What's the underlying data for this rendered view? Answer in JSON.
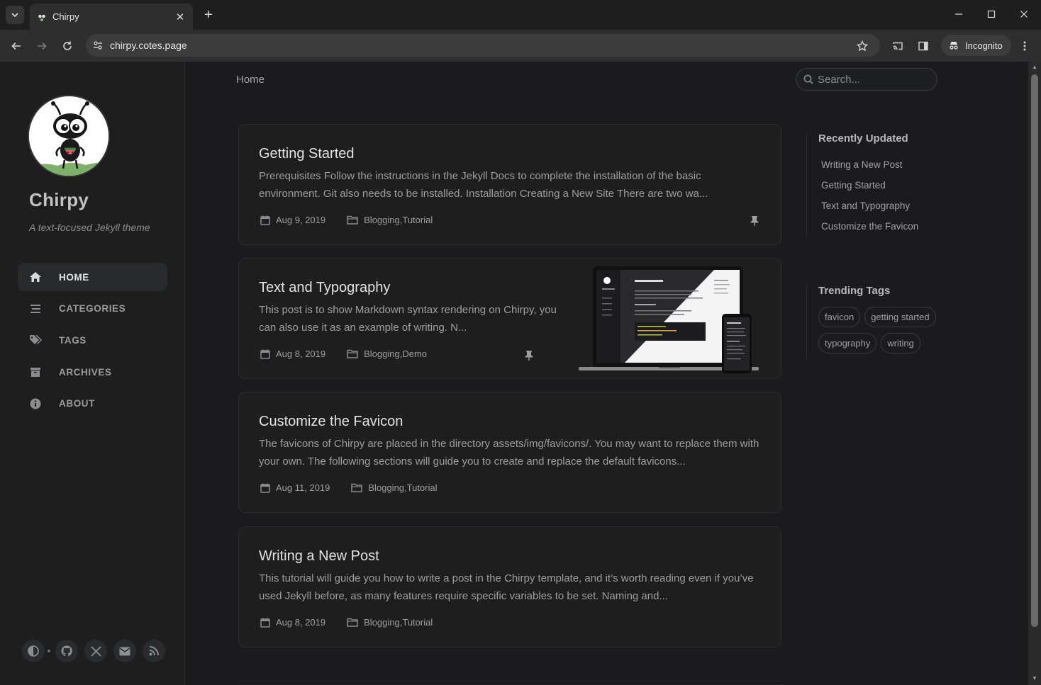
{
  "browser": {
    "tab_title": "Chirpy",
    "url": "chirpy.cotes.page",
    "incognito_label": "Incognito"
  },
  "sidebar": {
    "site_title": "Chirpy",
    "subtitle": "A text-focused Jekyll theme",
    "nav": [
      {
        "label": "HOME",
        "icon": "home-icon",
        "active": true
      },
      {
        "label": "CATEGORIES",
        "icon": "stream-icon"
      },
      {
        "label": "TAGS",
        "icon": "tags-icon"
      },
      {
        "label": "ARCHIVES",
        "icon": "archive-icon"
      },
      {
        "label": "ABOUT",
        "icon": "info-icon"
      }
    ],
    "bottom_icons": [
      "theme-toggle-icon",
      "github-icon",
      "x-twitter-icon",
      "email-icon",
      "rss-icon"
    ]
  },
  "topbar": {
    "breadcrumb": "Home",
    "search_placeholder": "Search..."
  },
  "posts": [
    {
      "title": "Getting Started",
      "excerpt": "Prerequisites Follow the instructions in the Jekyll Docs to complete the installation of the basic environment. Git also needs to be installed. Installation Creating a New Site There are two wa...",
      "date": "Aug 9, 2019",
      "categories": [
        "Blogging",
        "Tutorial"
      ],
      "pinned": true
    },
    {
      "title": "Text and Typography",
      "excerpt": "This post is to show Markdown syntax rendering on Chirpy, you can also use it as an example of writing. N...",
      "date": "Aug 8, 2019",
      "categories": [
        "Blogging",
        "Demo"
      ],
      "pinned": true,
      "has_image": true
    },
    {
      "title": "Customize the Favicon",
      "excerpt": "The favicons of Chirpy are placed in the directory assets/img/favicons/. You may want to replace them with your own. The following sections will guide you to create and replace the default favicons...",
      "date": "Aug 11, 2019",
      "categories": [
        "Blogging",
        "Tutorial"
      ],
      "pinned": false
    },
    {
      "title": "Writing a New Post",
      "excerpt": "This tutorial will guide you how to write a post in the Chirpy template, and it’s worth reading even if you’ve used Jekyll before, as many features require specific variables to be set. Naming and...",
      "date": "Aug 8, 2019",
      "categories": [
        "Blogging",
        "Tutorial"
      ],
      "pinned": false
    }
  ],
  "recently_updated": {
    "heading": "Recently Updated",
    "items": [
      "Writing a New Post",
      "Getting Started",
      "Text and Typography",
      "Customize the Favicon"
    ]
  },
  "trending_tags": {
    "heading": "Trending Tags",
    "tags": [
      "favicon",
      "getting started",
      "typography",
      "writing"
    ]
  }
}
